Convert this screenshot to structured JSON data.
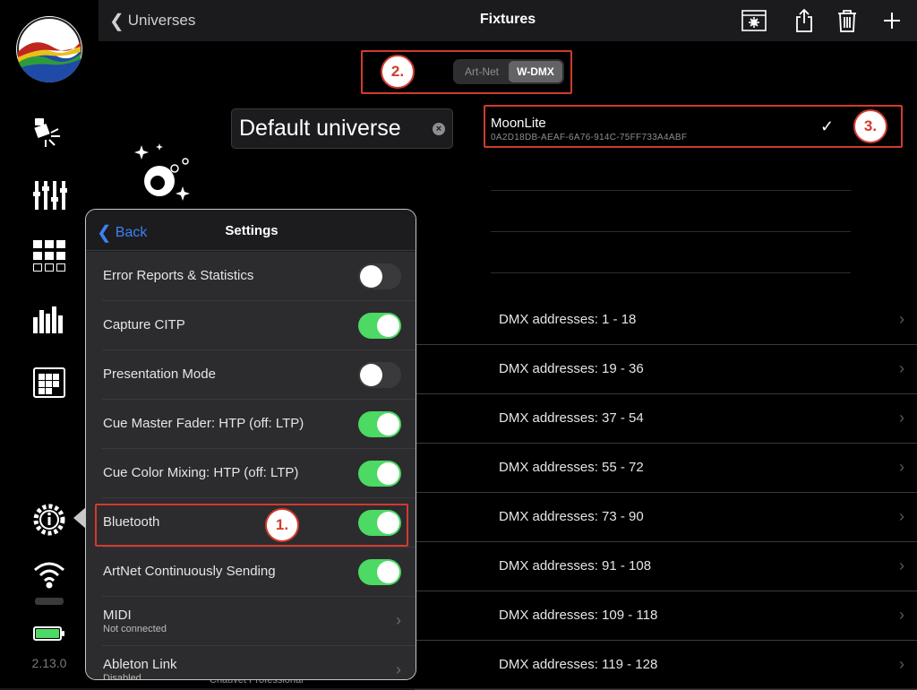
{
  "topbar": {
    "back_label": "Universes",
    "title": "Fixtures"
  },
  "sidebar": {
    "version": "2.13.0"
  },
  "protocol": {
    "options": [
      "Art-Net",
      "W-DMX"
    ],
    "selected": "W-DMX"
  },
  "universe": {
    "name": "Default universe"
  },
  "device": {
    "name": "MoonLite",
    "id": "0A2D18DB-AEAF-6A76-914C-75FF733A4ABF"
  },
  "annotations": [
    "1.",
    "2.",
    "3."
  ],
  "dmx_rows": [
    "DMX addresses: 1 - 18",
    "DMX addresses: 19 - 36",
    "DMX addresses: 37 - 54",
    "DMX addresses: 55 - 72",
    "DMX addresses: 73 - 90",
    "DMX addresses: 91 - 108",
    "DMX addresses: 109 - 118",
    "DMX addresses: 119 - 128"
  ],
  "footer_text": "Chauvet Professional",
  "settings": {
    "back_label": "Back",
    "title": "Settings",
    "rows": [
      {
        "label": "Error Reports & Statistics",
        "on": false
      },
      {
        "label": "Capture CITP",
        "on": true
      },
      {
        "label": "Presentation Mode",
        "on": false
      },
      {
        "label": "Cue Master Fader: HTP (off: LTP)",
        "on": true
      },
      {
        "label": "Cue Color Mixing: HTP (off: LTP)",
        "on": true
      },
      {
        "label": "Bluetooth",
        "on": true
      },
      {
        "label": "ArtNet Continuously Sending",
        "on": true
      }
    ],
    "midi": {
      "label": "MIDI",
      "status": "Not connected"
    },
    "ableton": {
      "label": "Ableton Link",
      "status": "Disabled"
    }
  },
  "colors": {
    "accent_blue": "#3b82f6",
    "toggle_on": "#4cd964",
    "annotation_red": "#d23a2e"
  }
}
